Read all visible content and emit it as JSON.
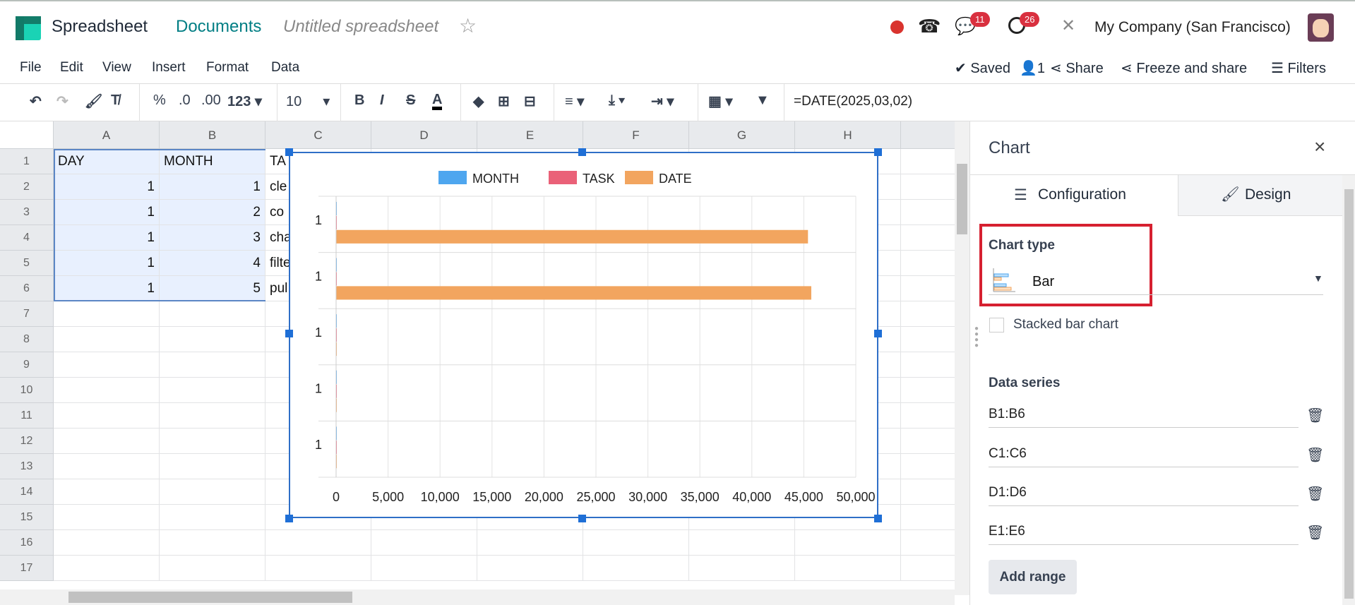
{
  "topbar": {
    "app": "Spreadsheet",
    "breadcrumb": "Documents",
    "doc_title": "Untitled spreadsheet",
    "messages_badge": "11",
    "activities_badge": "26",
    "company": "My Company (San Francisco)"
  },
  "menu": [
    "File",
    "Edit",
    "View",
    "Insert",
    "Format",
    "Data"
  ],
  "actions": {
    "saved": "Saved",
    "users": "1",
    "share": "Share",
    "freeze": "Freeze and share",
    "filters": "Filters"
  },
  "toolbar": {
    "percent": "%",
    "dec_less": ".0",
    "dec_more": ".00",
    "format": "123",
    "font_size": "10",
    "formula": "=DATE(2025,03,02)"
  },
  "grid": {
    "columns": [
      "A",
      "B",
      "C",
      "D",
      "E",
      "F",
      "G",
      "H"
    ],
    "rows": [
      "1",
      "2",
      "3",
      "4",
      "5",
      "6",
      "7",
      "8",
      "9",
      "10",
      "11",
      "12",
      "13",
      "14",
      "15",
      "16",
      "17"
    ],
    "cells": [
      [
        "DAY",
        "MONTH",
        "TA"
      ],
      [
        "1",
        "1",
        "cle"
      ],
      [
        "1",
        "2",
        "co"
      ],
      [
        "1",
        "3",
        "cha"
      ],
      [
        "1",
        "4",
        "filte"
      ],
      [
        "1",
        "5",
        "pul"
      ]
    ]
  },
  "chart_data": {
    "type": "bar",
    "orientation": "horizontal",
    "categories": [
      "1",
      "1",
      "1",
      "1",
      "1"
    ],
    "series": [
      {
        "name": "MONTH",
        "color": "#4ea6ef",
        "values": [
          1,
          2,
          3,
          4,
          5
        ]
      },
      {
        "name": "TASK",
        "color": "#ea6178",
        "values": [
          0,
          0,
          0,
          0,
          0
        ]
      },
      {
        "name": "DATE",
        "color": "#f2a55f",
        "values": [
          45400,
          45718,
          0,
          0,
          0
        ]
      }
    ],
    "xlim": [
      0,
      50000
    ],
    "xticks": [
      "0",
      "5,000",
      "10,000",
      "15,000",
      "20,000",
      "25,000",
      "30,000",
      "35,000",
      "40,000",
      "45,000",
      "50,000"
    ],
    "legend": "top",
    "grid": true
  },
  "panel": {
    "title": "Chart",
    "tab_config": "Configuration",
    "tab_design": "Design",
    "chart_type_label": "Chart type",
    "chart_type": "Bar",
    "stacked_label": "Stacked bar chart",
    "data_series_label": "Data series",
    "ranges": [
      "B1:B6",
      "C1:C6",
      "D1:D6",
      "E1:E6"
    ],
    "add_range": "Add range"
  }
}
